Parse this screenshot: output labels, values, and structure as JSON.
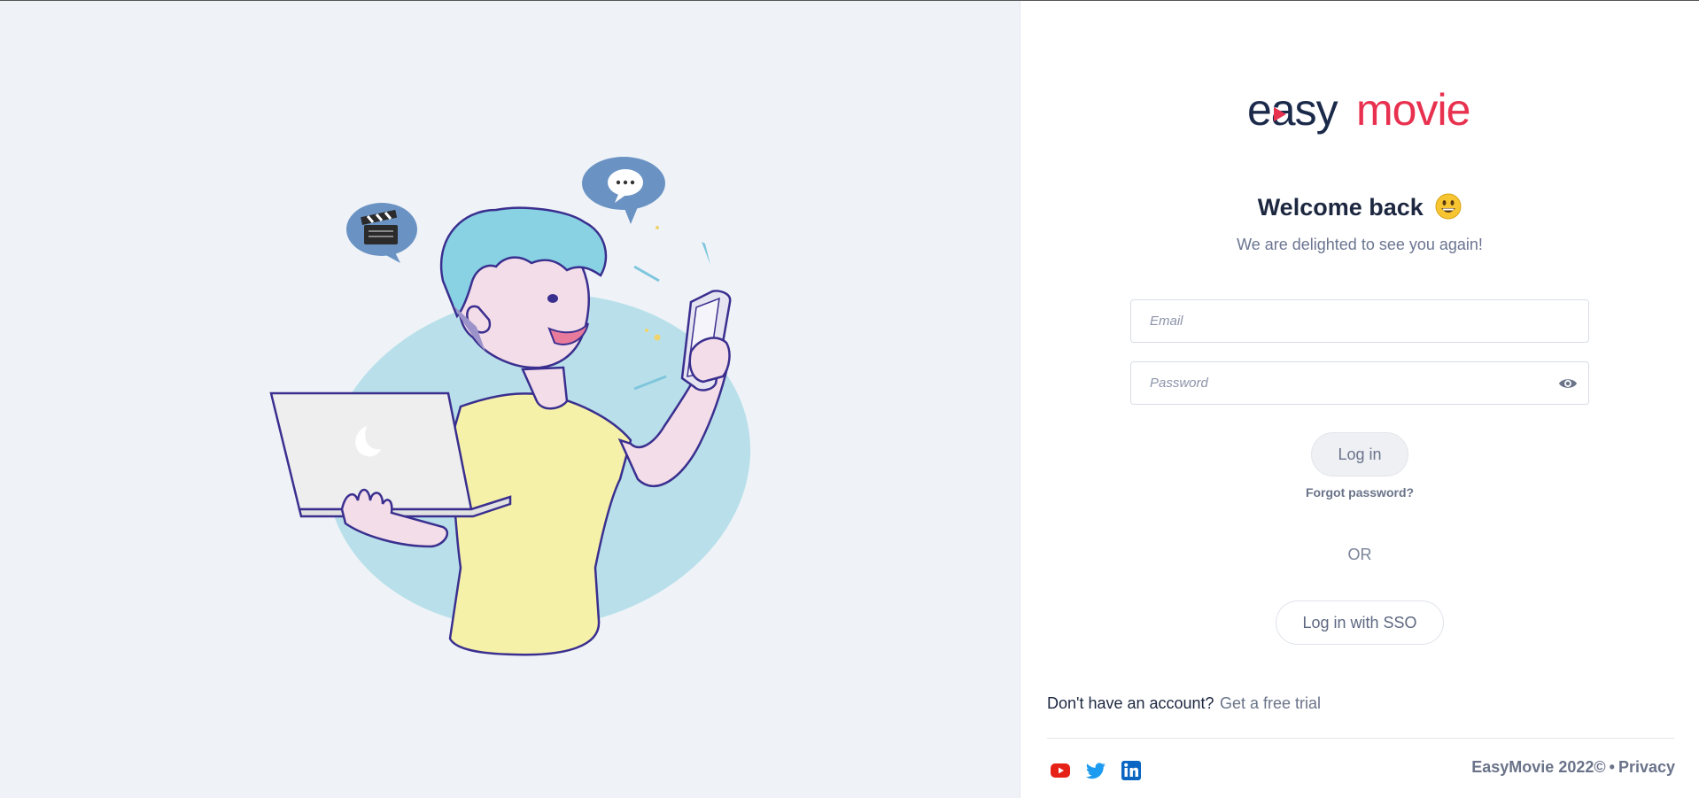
{
  "brand": {
    "name_part1": "easy",
    "name_part2": "movie",
    "primary_color": "#1b2a4a",
    "accent_color": "#e8304f"
  },
  "illustration": {
    "speech_bubble_left_icon": "clapperboard-icon",
    "speech_bubble_right_icon": "speech-dots-icon"
  },
  "login": {
    "title": "Welcome back",
    "title_emoji": "grinning-face-icon",
    "subtitle": "We are delighted to see you again!",
    "email_placeholder": "Email",
    "email_value": "",
    "password_placeholder": "Password",
    "password_value": "",
    "login_button": "Log in",
    "forgot_password": "Forgot password?",
    "or_text": "OR",
    "sso_button": "Log in with SSO"
  },
  "signup": {
    "prompt": "Don't have an account?",
    "link": "Get a free trial"
  },
  "footer": {
    "social": [
      "youtube-icon",
      "twitter-icon",
      "linkedin-icon"
    ],
    "copyright": "EasyMovie 2022©",
    "separator": "•",
    "privacy": "Privacy"
  }
}
